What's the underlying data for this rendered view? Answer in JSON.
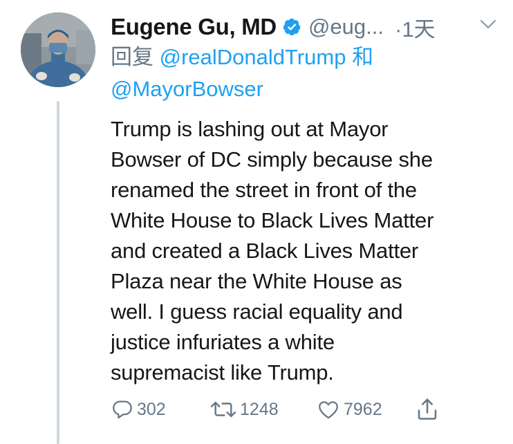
{
  "author": {
    "display_name": "Eugene Gu, MD",
    "handle": "@eug...",
    "time_sep": "·",
    "time": "1天",
    "verified": true
  },
  "reply": {
    "prefix": "回复",
    "mention1": "@realDonaldTrump",
    "joiner": "和",
    "mention2": "@MayorBowser"
  },
  "tweet": {
    "lines": [
      "Trump is lashing out at Mayor",
      "Bowser of DC simply because she",
      "renamed the street in front of the",
      "White House to Black Lives Matter",
      "and created a Black Lives Matter",
      "Plaza near the White House as",
      "well. I guess racial equality and",
      "justice infuriates a white",
      "supremacist like Trump."
    ]
  },
  "actions": {
    "replies": "302",
    "retweets": "1248",
    "likes": "7962"
  },
  "icons": {
    "verified": "verified-badge-icon",
    "caret": "chevron-down-icon",
    "reply": "reply-icon",
    "retweet": "retweet-icon",
    "like": "heart-icon",
    "share": "share-icon"
  },
  "colors": {
    "accent": "#1da1f2",
    "muted": "#657786",
    "text": "#14171a",
    "thread_line": "#ccd6dd"
  }
}
